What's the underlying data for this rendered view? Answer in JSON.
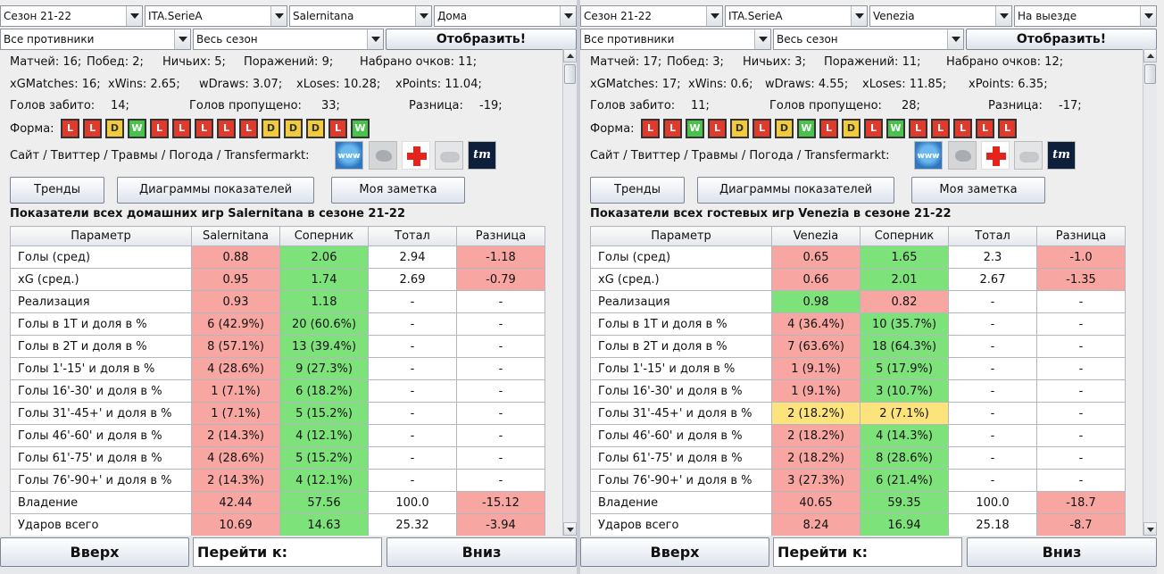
{
  "left": {
    "combos": {
      "season": "Сезон 21-22",
      "league": "ITA.SerieA",
      "team": "Salernitana",
      "venue": "Дома",
      "opponents": "Все противники",
      "period": "Весь сезон"
    },
    "show_button": "Отобразить!",
    "stats": {
      "line1": [
        "Матчей: 16;",
        "Побед: 2;",
        "Ничьих: 5;",
        "Поражений: 9;",
        "Набрано очков: 11;"
      ],
      "line2": [
        "xGMatches: 16;",
        "xWins: 2.65;",
        "wDraws: 3.07;",
        "xLoses: 10.28;",
        "xPoints: 11.04;"
      ],
      "line3": [
        "Голов забито:",
        "14;",
        "Голов пропущено:",
        "33;",
        "Разница:",
        "-19;"
      ]
    },
    "form_label": "Форма:",
    "form": [
      "L",
      "L",
      "D",
      "W",
      "L",
      "L",
      "L",
      "L",
      "L",
      "D",
      "D",
      "D",
      "L",
      "W"
    ],
    "links_label": "Сайт / Твиттер / Травмы / Погода / Transfermarkt:",
    "icons": {
      "www": "www",
      "tm": "tm"
    },
    "buttons": {
      "trends": "Тренды",
      "charts": "Диаграммы показателей",
      "note": "Моя заметка"
    },
    "caption": "Показатели всех домашних игр Salernitana в сезоне 21-22",
    "columns": [
      "Параметр",
      "Salernitana",
      "Соперник",
      "Тотал",
      "Разница"
    ],
    "rows": [
      [
        "Голы (сред)",
        "0.88",
        "2.06",
        "2.94",
        "-1.18"
      ],
      [
        "xG (сред.)",
        "0.95",
        "1.74",
        "2.69",
        "-0.79"
      ],
      [
        "Реализация",
        "0.93",
        "1.18",
        "-",
        "-"
      ],
      [
        "Голы в 1Т и доля в %",
        "6 (42.9%)",
        "20 (60.6%)",
        "-",
        "-"
      ],
      [
        "Голы в 2Т и доля в %",
        "8 (57.1%)",
        "13 (39.4%)",
        "-",
        "-"
      ],
      [
        "Голы 1'-15' и доля в %",
        "4 (28.6%)",
        "9 (27.3%)",
        "-",
        "-"
      ],
      [
        "Голы 16'-30' и доля в %",
        "1 (7.1%)",
        "6 (18.2%)",
        "-",
        "-"
      ],
      [
        "Голы 31'-45+' и доля в %",
        "1 (7.1%)",
        "5 (15.2%)",
        "-",
        "-"
      ],
      [
        "Голы 46'-60' и доля в %",
        "2 (14.3%)",
        "4 (12.1%)",
        "-",
        "-"
      ],
      [
        "Голы 61'-75' и доля в %",
        "4 (28.6%)",
        "5 (15.2%)",
        "-",
        "-"
      ],
      [
        "Голы 76'-90+' и доля в %",
        "2 (14.3%)",
        "4 (12.1%)",
        "-",
        "-"
      ],
      [
        "Владение",
        "42.44",
        "57.56",
        "100.0",
        "-15.12"
      ],
      [
        "Ударов всего",
        "10.69",
        "14.63",
        "25.32",
        "-3.94"
      ]
    ],
    "row_colors": [
      [
        "r",
        "g",
        "w",
        "r"
      ],
      [
        "r",
        "g",
        "w",
        "r"
      ],
      [
        "r",
        "g",
        "w",
        "w"
      ],
      [
        "r",
        "g",
        "w",
        "w"
      ],
      [
        "r",
        "g",
        "w",
        "w"
      ],
      [
        "r",
        "g",
        "w",
        "w"
      ],
      [
        "r",
        "g",
        "w",
        "w"
      ],
      [
        "r",
        "g",
        "w",
        "w"
      ],
      [
        "r",
        "g",
        "w",
        "w"
      ],
      [
        "r",
        "g",
        "w",
        "w"
      ],
      [
        "r",
        "g",
        "w",
        "w"
      ],
      [
        "r",
        "g",
        "w",
        "r"
      ],
      [
        "r",
        "g",
        "w",
        "r"
      ]
    ],
    "bottom": {
      "up": "Вверх",
      "goto": "Перейти к:",
      "down": "Вниз"
    }
  },
  "right": {
    "combos": {
      "season": "Сезон 21-22",
      "league": "ITA.SerieA",
      "team": "Venezia",
      "venue": "На выезде",
      "opponents": "Все противники",
      "period": "Весь сезон"
    },
    "show_button": "Отобразить!",
    "stats": {
      "line1": [
        "Матчей: 17;",
        "Побед: 3;",
        "Ничьих: 3;",
        "Поражений: 11;",
        "Набрано очков: 12;"
      ],
      "line2": [
        "xGMatches: 17;",
        "xWins: 0.6;",
        "wDraws: 4.55;",
        "xLoses: 11.85;",
        "xPoints: 6.35;"
      ],
      "line3": [
        "Голов забито:",
        "11;",
        "Голов пропущено:",
        "28;",
        "Разница:",
        "-17;"
      ]
    },
    "form_label": "Форма:",
    "form": [
      "L",
      "L",
      "W",
      "L",
      "D",
      "L",
      "D",
      "W",
      "L",
      "D",
      "L",
      "W",
      "L",
      "L",
      "L",
      "L",
      "L"
    ],
    "links_label": "Сайт / Твиттер / Травмы / Погода / Transfermarkt:",
    "icons": {
      "www": "www",
      "tm": "tm"
    },
    "buttons": {
      "trends": "Тренды",
      "charts": "Диаграммы показателей",
      "note": "Моя заметка"
    },
    "caption": "Показатели всех гостевых игр Venezia в сезоне 21-22",
    "columns": [
      "Параметр",
      "Venezia",
      "Соперник",
      "Тотал",
      "Разница"
    ],
    "rows": [
      [
        "Голы (сред)",
        "0.65",
        "1.65",
        "2.3",
        "-1.0"
      ],
      [
        "xG (сред.)",
        "0.66",
        "2.01",
        "2.67",
        "-1.35"
      ],
      [
        "Реализация",
        "0.98",
        "0.82",
        "-",
        "-"
      ],
      [
        "Голы в 1Т и доля в %",
        "4 (36.4%)",
        "10 (35.7%)",
        "-",
        "-"
      ],
      [
        "Голы в 2Т и доля в %",
        "7 (63.6%)",
        "18 (64.3%)",
        "-",
        "-"
      ],
      [
        "Голы 1'-15' и доля в %",
        "1 (9.1%)",
        "5 (17.9%)",
        "-",
        "-"
      ],
      [
        "Голы 16'-30' и доля в %",
        "1 (9.1%)",
        "3 (10.7%)",
        "-",
        "-"
      ],
      [
        "Голы 31'-45+' и доля в %",
        "2 (18.2%)",
        "2 (7.1%)",
        "-",
        "-"
      ],
      [
        "Голы 46'-60' и доля в %",
        "2 (18.2%)",
        "4 (14.3%)",
        "-",
        "-"
      ],
      [
        "Голы 61'-75' и доля в %",
        "2 (18.2%)",
        "8 (28.6%)",
        "-",
        "-"
      ],
      [
        "Голы 76'-90+' и доля в %",
        "3 (27.3%)",
        "6 (21.4%)",
        "-",
        "-"
      ],
      [
        "Владение",
        "40.65",
        "59.35",
        "100.0",
        "-18.7"
      ],
      [
        "Ударов всего",
        "8.24",
        "16.94",
        "25.18",
        "-8.7"
      ]
    ],
    "row_colors": [
      [
        "r",
        "g",
        "w",
        "r"
      ],
      [
        "r",
        "g",
        "w",
        "r"
      ],
      [
        "g",
        "r",
        "w",
        "w"
      ],
      [
        "r",
        "g",
        "w",
        "w"
      ],
      [
        "r",
        "g",
        "w",
        "w"
      ],
      [
        "r",
        "g",
        "w",
        "w"
      ],
      [
        "r",
        "g",
        "w",
        "w"
      ],
      [
        "y",
        "y",
        "w",
        "w"
      ],
      [
        "r",
        "g",
        "w",
        "w"
      ],
      [
        "r",
        "g",
        "w",
        "w"
      ],
      [
        "r",
        "g",
        "w",
        "w"
      ],
      [
        "r",
        "g",
        "w",
        "r"
      ],
      [
        "r",
        "g",
        "w",
        "r"
      ]
    ],
    "bottom": {
      "up": "Вверх",
      "goto": "Перейти к:",
      "down": "Вниз"
    }
  }
}
